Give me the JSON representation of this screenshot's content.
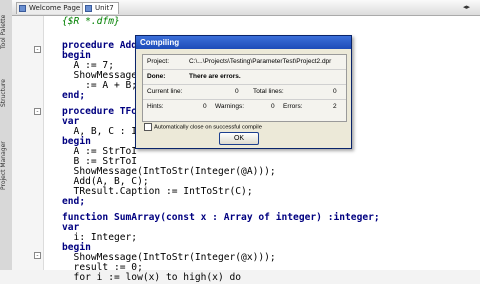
{
  "side_tabs": [
    "Tool Palette",
    "Structure",
    "Project Manager"
  ],
  "tabs": [
    {
      "label": "Welcome Page",
      "active": false
    },
    {
      "label": "Unit7",
      "active": true
    }
  ],
  "code_lines": [
    "{$R *.dfm}",
    "",
    "procedure Add(",
    "begin",
    "  A := 7;",
    "  ShowMessage(",
    "    := A + B;",
    "end;",
    "",
    "procedure TFo",
    "var",
    "  A, B, C : I",
    "begin",
    "  A := StrToI",
    "  B := StrToI",
    "  ShowMessage(IntToStr(Integer(@A)));",
    "  Add(A, B, C);",
    "  TResult.Caption := IntToStr(C);",
    "end;",
    "",
    "function SumArray(const x : Array of integer) :integer;",
    "var",
    "  i: Integer;",
    "begin",
    "  ShowMessage(IntToStr(Integer(@x)));",
    "  result := 0;",
    "  for i := low(x) to high(x) do"
  ],
  "dialog": {
    "title": "Compiling",
    "project_label": "Project:",
    "project_value": "C:\\...\\Projects\\Testing\\ParameterTest\\Project2.dpr",
    "done_label": "Done:",
    "done_value": "There are errors.",
    "current_line_label": "Current line:",
    "current_line_value": "0",
    "total_lines_label": "Total lines:",
    "total_lines_value": "0",
    "hints_label": "Hints:",
    "hints_value": "0",
    "warnings_label": "Warnings:",
    "warnings_value": "0",
    "errors_label": "Errors:",
    "errors_value": "2",
    "auto_close_label": "Automatically close on successful compile",
    "ok_label": "OK"
  }
}
